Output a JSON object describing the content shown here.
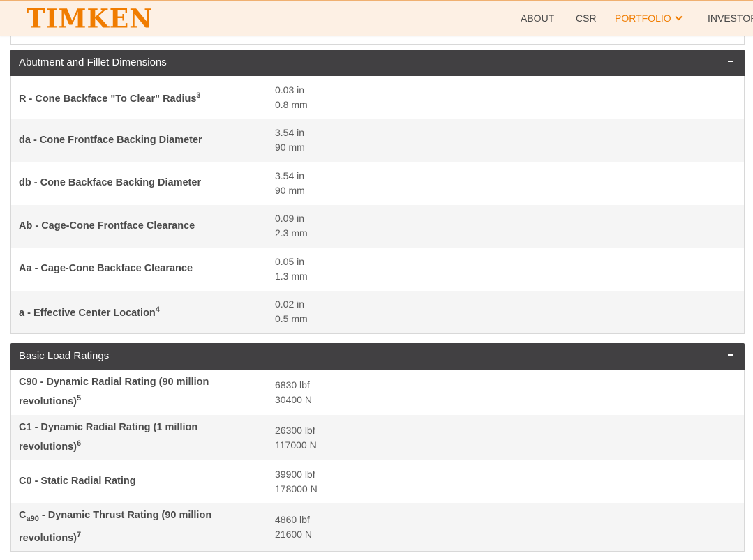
{
  "header": {
    "logo": "TIMKEN",
    "nav": [
      "ABOUT",
      "CSR",
      "PORTFOLIO",
      "INVESTOR"
    ],
    "active": "PORTFOLIO",
    "brand_color": "#f07c00"
  },
  "abutment": {
    "title": "Abutment and Fillet Dimensions",
    "rows": [
      {
        "label": "R - Cone Backface \"To Clear\" Radius",
        "note": "3",
        "in": "0.03 in",
        "mm": "0.8 mm"
      },
      {
        "label": "da - Cone Frontface Backing Diameter",
        "note": "",
        "in": "3.54 in",
        "mm": "90 mm"
      },
      {
        "label": "db - Cone Backface Backing Diameter",
        "note": "",
        "in": "3.54 in",
        "mm": "90 mm"
      },
      {
        "label": "Ab - Cage-Cone Frontface Clearance",
        "note": "",
        "in": "0.09 in",
        "mm": "2.3 mm"
      },
      {
        "label": "Aa - Cage-Cone Backface Clearance",
        "note": "",
        "in": "0.05 in",
        "mm": "1.3 mm"
      },
      {
        "label": "a - Effective Center Location",
        "note": "4",
        "in": "0.02 in",
        "mm": "0.5 mm"
      }
    ]
  },
  "load_ratings": {
    "title": "Basic Load Ratings",
    "rows": [
      {
        "label_line1": "C90 - Dynamic Radial Rating (90 million",
        "label_line2": "revolutions)",
        "note": "5",
        "lbf": "6830 lbf",
        "n": "30400 N"
      },
      {
        "label_line1": "C1 - Dynamic Radial Rating (1 million",
        "label_line2": "revolutions)",
        "note": "6",
        "lbf": "26300 lbf",
        "n": "117000 N"
      },
      {
        "label": "C0 - Static Radial Rating",
        "lbf": "39900 lbf",
        "n": "178000 N"
      },
      {
        "label_pre": "C",
        "label_sub": "a90",
        "label_line1": " - Dynamic Thrust Rating (90 million",
        "label_line2": "revolutions)",
        "note": "7",
        "lbf": "4860 lbf",
        "n": "21600 N"
      }
    ]
  }
}
